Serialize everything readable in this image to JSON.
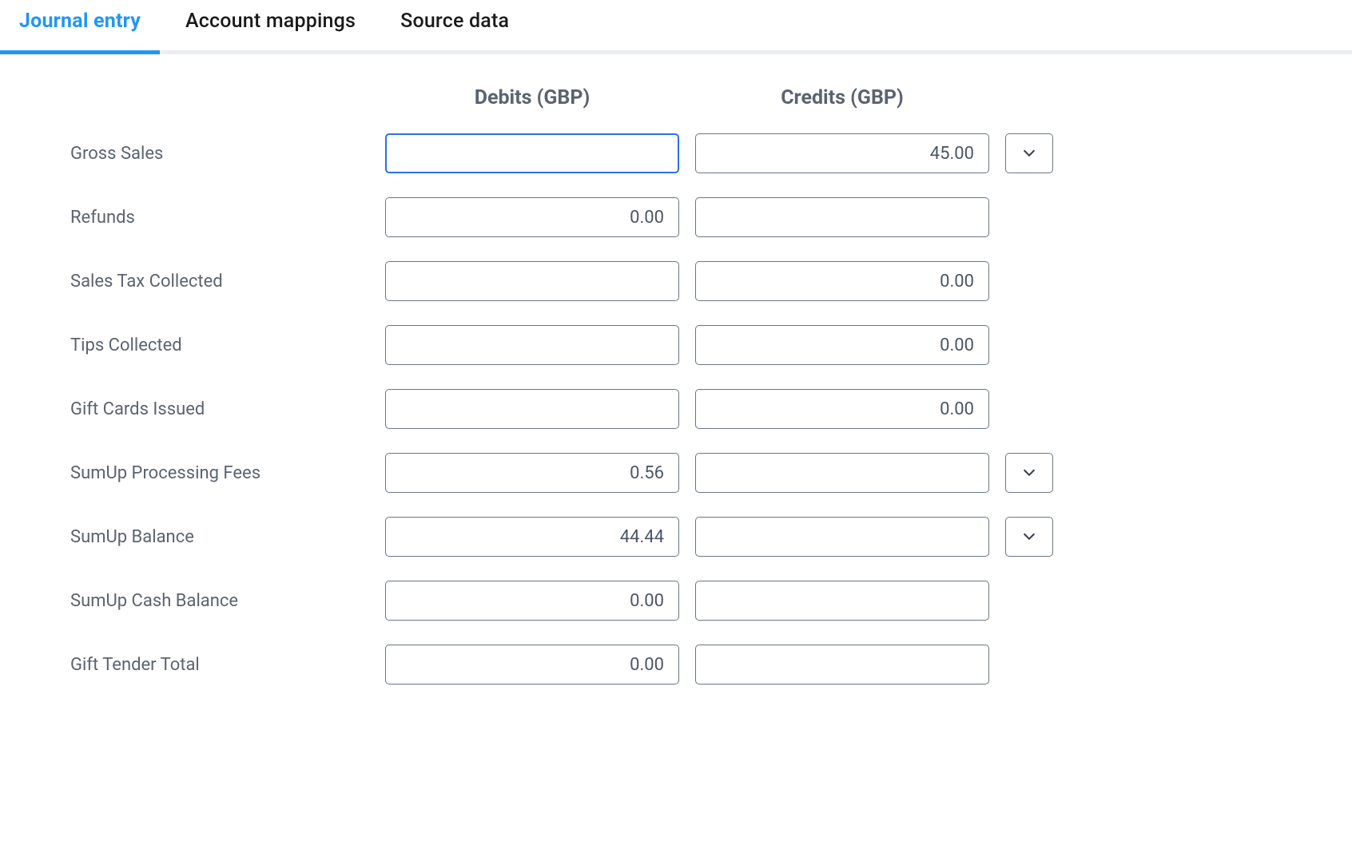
{
  "tabs": {
    "journal_entry": "Journal entry",
    "account_mappings": "Account mappings",
    "source_data": "Source data"
  },
  "columns": {
    "debits": "Debits (GBP)",
    "credits": "Credits (GBP)"
  },
  "rows": {
    "gross_sales": {
      "label": "Gross Sales",
      "debit": "",
      "credit": "45.00",
      "expandable": true
    },
    "refunds": {
      "label": "Refunds",
      "debit": "0.00",
      "credit": "",
      "expandable": false
    },
    "sales_tax_collected": {
      "label": "Sales Tax Collected",
      "debit": "",
      "credit": "0.00",
      "expandable": false
    },
    "tips_collected": {
      "label": "Tips Collected",
      "debit": "",
      "credit": "0.00",
      "expandable": false
    },
    "gift_cards_issued": {
      "label": "Gift Cards Issued",
      "debit": "",
      "credit": "0.00",
      "expandable": false
    },
    "sumup_processing_fees": {
      "label": "SumUp Processing Fees",
      "debit": "0.56",
      "credit": "",
      "expandable": true
    },
    "sumup_balance": {
      "label": "SumUp Balance",
      "debit": "44.44",
      "credit": "",
      "expandable": true
    },
    "sumup_cash_balance": {
      "label": "SumUp Cash Balance",
      "debit": "0.00",
      "credit": "",
      "expandable": false
    },
    "gift_tender_total": {
      "label": "Gift Tender Total",
      "debit": "0.00",
      "credit": "",
      "expandable": false
    }
  }
}
